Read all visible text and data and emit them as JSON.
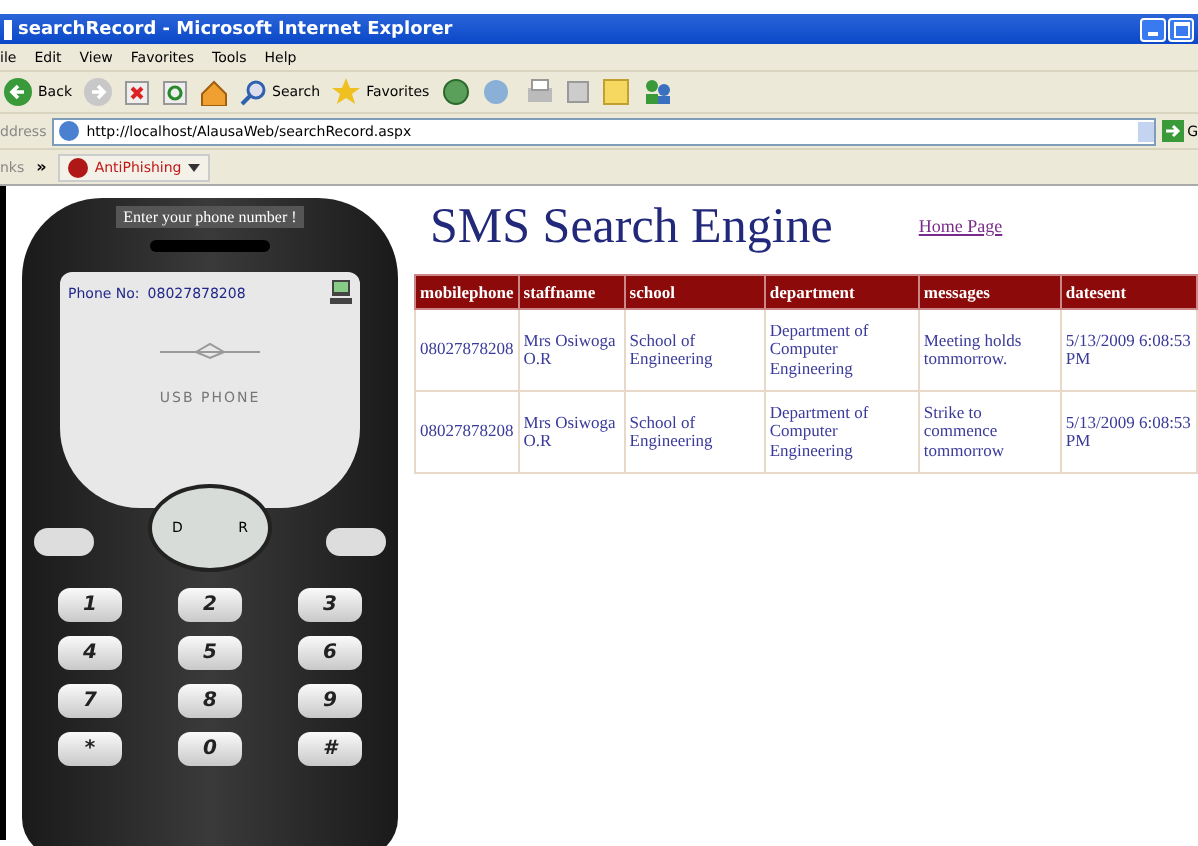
{
  "window": {
    "title": "searchRecord - Microsoft Internet Explorer"
  },
  "menu": [
    "ile",
    "Edit",
    "View",
    "Favorites",
    "Tools",
    "Help"
  ],
  "toolbar": {
    "back": "Back",
    "search": "Search",
    "favorites": "Favorites"
  },
  "address_bar": {
    "label": "ddress",
    "url": "http://localhost/AlausaWeb/searchRecord.aspx",
    "go": "G"
  },
  "links_bar": {
    "label": "nks",
    "chevron": "»",
    "item": "AntiPhishing"
  },
  "phone": {
    "caption": "Enter your phone number !",
    "phone_label": "Phone No:",
    "phone_number": "08027878208",
    "brand": "USB PHONE",
    "nav": [
      "D",
      "R"
    ],
    "keys": [
      "1",
      "2",
      "3",
      "4",
      "5",
      "6",
      "7",
      "8",
      "9",
      "*",
      "0",
      "#"
    ]
  },
  "page": {
    "heading": "SMS Search Engine",
    "home_link": "Home Page"
  },
  "table": {
    "columns": [
      "mobilephone",
      "staffname",
      "school",
      "department",
      "messages",
      "datesent"
    ],
    "rows": [
      [
        "08027878208",
        "Mrs Osiwoga O.R",
        "School of Engineering",
        "Department of Computer Engineering",
        "Meeting holds tommorrow.",
        "5/13/2009 6:08:53 PM"
      ],
      [
        "08027878208",
        "Mrs Osiwoga O.R",
        "School of Engineering",
        "Department of Computer Engineering",
        "Strike to commence tommorrow",
        "5/13/2009 6:08:53 PM"
      ]
    ]
  }
}
